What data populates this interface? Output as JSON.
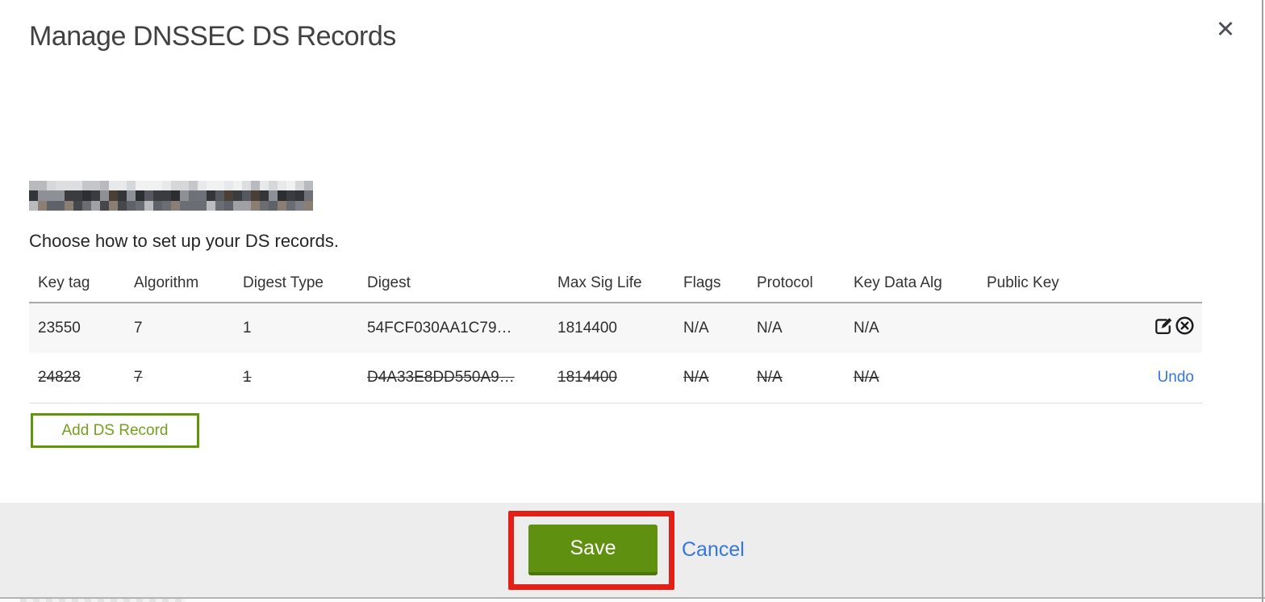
{
  "modal": {
    "title": "Manage DNSSEC DS Records",
    "instruction": "Choose how to set up your DS records.",
    "close_glyph": "✕"
  },
  "table": {
    "columns": [
      "Key tag",
      "Algorithm",
      "Digest Type",
      "Digest",
      "Max Sig Life",
      "Flags",
      "Protocol",
      "Key Data Alg",
      "Public Key"
    ],
    "rows": [
      {
        "cells": [
          "23550",
          "7",
          "1",
          "54FCF030AA1C79…",
          "1814400",
          "N/A",
          "N/A",
          "N/A",
          ""
        ],
        "deleted": false,
        "actions": [
          "edit",
          "delete"
        ]
      },
      {
        "cells": [
          "24828",
          "7",
          "1",
          "D4A33E8DD550A9…",
          "1814400",
          "N/A",
          "N/A",
          "N/A",
          ""
        ],
        "deleted": true,
        "action": "Undo"
      }
    ]
  },
  "buttons": {
    "add_ds_record": "Add DS Record",
    "save": "Save",
    "cancel": "Cancel"
  },
  "colors": {
    "title-text": "#414141",
    "body-text": "#2e2e2e",
    "green": "#61950a",
    "green-text": "#75a01d",
    "save-bg": "#5f9010",
    "save-bg-dark": "#4c7609",
    "link-blue": "#3477e0",
    "annotation-red": "#e32017",
    "row-alt-bg": "#f7f7f7",
    "footer-bg": "#ededed",
    "header-border": "#a9a9a9",
    "row-border": "#dcdcdc"
  }
}
